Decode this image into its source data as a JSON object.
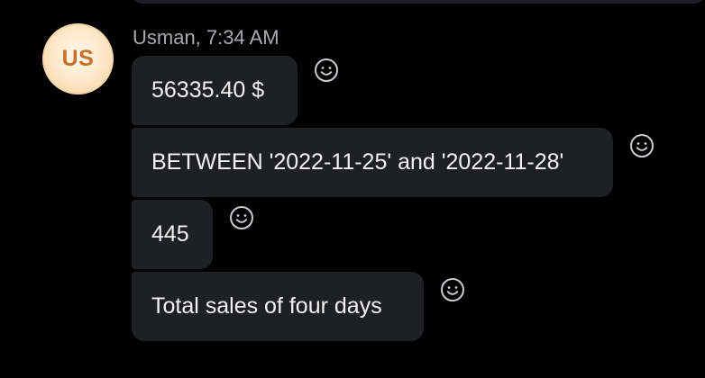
{
  "message": {
    "avatar_initials": "US",
    "meta": "Usman, 7:34 AM",
    "bubbles": [
      {
        "text": "56335.40 $"
      },
      {
        "text": "BETWEEN '2022-11-25' and '2022-11-28'"
      },
      {
        "text": "445"
      },
      {
        "text": "Total sales of four days"
      }
    ],
    "reaction_icon": "smiley-face-icon"
  },
  "colors": {
    "background": "#000000",
    "bubble": "#1f2023",
    "meta_text": "#a9abb0",
    "avatar_text": "#c8702a",
    "icon_stroke": "#c9cbd0"
  }
}
